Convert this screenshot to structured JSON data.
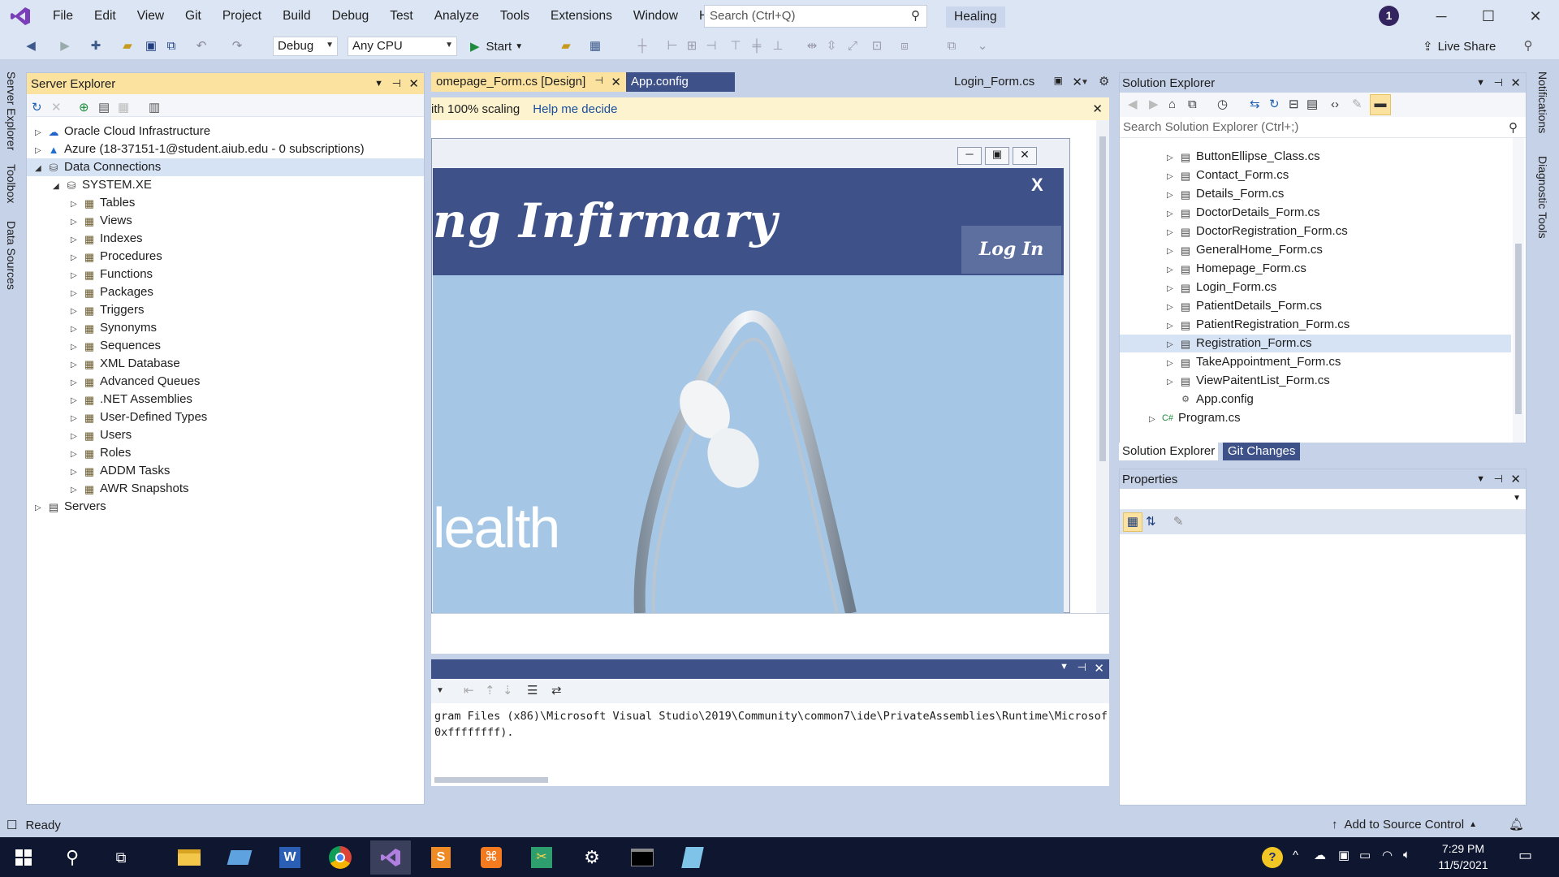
{
  "menu": {
    "items": [
      "File",
      "Edit",
      "View",
      "Git",
      "Project",
      "Build",
      "Debug",
      "Test",
      "Analyze",
      "Tools",
      "Extensions",
      "Window",
      "Help"
    ],
    "search_placeholder": "Search (Ctrl+Q)",
    "solution_name": "Healing",
    "profile_initial": "1"
  },
  "toolbar": {
    "configuration": "Debug",
    "platform": "Any CPU",
    "start_label": "Start",
    "live_share_label": "Live Share"
  },
  "left_tabs": [
    "Server Explorer",
    "Toolbox",
    "Data Sources"
  ],
  "right_tabs": [
    "Notifications",
    "Diagnostic Tools"
  ],
  "server_explorer": {
    "title": "Server Explorer",
    "nodes": [
      {
        "label": "Oracle Cloud Infrastructure",
        "icon": "cloud-icon"
      },
      {
        "label": "Azure (18-37151-1@student.aiub.edu - 0 subscriptions)",
        "icon": "azure-icon"
      },
      {
        "label": "Data Connections",
        "icon": "data-connections-icon"
      },
      {
        "label": "SYSTEM.XE",
        "icon": "database-icon"
      },
      {
        "label": "Tables",
        "icon": "table-icon"
      },
      {
        "label": "Views",
        "icon": "view-icon"
      },
      {
        "label": "Indexes",
        "icon": "index-icon"
      },
      {
        "label": "Procedures",
        "icon": "procedure-icon"
      },
      {
        "label": "Functions",
        "icon": "function-icon"
      },
      {
        "label": "Packages",
        "icon": "package-icon"
      },
      {
        "label": "Triggers",
        "icon": "trigger-icon"
      },
      {
        "label": "Synonyms",
        "icon": "synonym-icon"
      },
      {
        "label": "Sequences",
        "icon": "sequence-icon"
      },
      {
        "label": "XML Database",
        "icon": "xml-icon"
      },
      {
        "label": "Advanced Queues",
        "icon": "queue-icon"
      },
      {
        "label": ".NET Assemblies",
        "icon": "assembly-icon"
      },
      {
        "label": "User-Defined Types",
        "icon": "type-icon"
      },
      {
        "label": "Users",
        "icon": "users-icon"
      },
      {
        "label": "Roles",
        "icon": "roles-icon"
      },
      {
        "label": "ADDM Tasks",
        "icon": "task-icon"
      },
      {
        "label": "AWR Snapshots",
        "icon": "snapshot-icon"
      },
      {
        "label": "Servers",
        "icon": "server-icon"
      }
    ]
  },
  "documents": {
    "tabs": [
      "omepage_Form.cs [Design]",
      "App.config",
      "Login_Form.cs"
    ],
    "infobar_text": "ith 100% scaling",
    "infobar_link": "Help me decide"
  },
  "designer_form": {
    "title_text": "ng Infirmary",
    "close_label": "X",
    "login_label": "Log In",
    "health_text": "lealth"
  },
  "output": {
    "line1": "gram Files (x86)\\Microsoft Visual Studio\\2019\\Community\\common7\\ide\\PrivateAssemblies\\Runtime\\Microsof",
    "line2": "0xffffffff)."
  },
  "solution_explorer": {
    "title": "Solution Explorer",
    "search_placeholder": "Search Solution Explorer (Ctrl+;)",
    "files": [
      "ButtonEllipse_Class.cs",
      "Contact_Form.cs",
      "Details_Form.cs",
      "DoctorDetails_Form.cs",
      "DoctorRegistration_Form.cs",
      "GeneralHome_Form.cs",
      "Homepage_Form.cs",
      "Login_Form.cs",
      "PatientDetails_Form.cs",
      "PatientRegistration_Form.cs",
      "Registration_Form.cs",
      "TakeAppointment_Form.cs",
      "ViewPaitentList_Form.cs"
    ],
    "extra": [
      "App.config",
      "Program.cs"
    ],
    "tab_solution": "Solution Explorer",
    "tab_git": "Git Changes"
  },
  "properties": {
    "title": "Properties"
  },
  "status": {
    "ready": "Ready",
    "source_control": "Add to Source Control"
  },
  "taskbar": {
    "time": "7:29 PM",
    "date": "11/5/2021"
  }
}
